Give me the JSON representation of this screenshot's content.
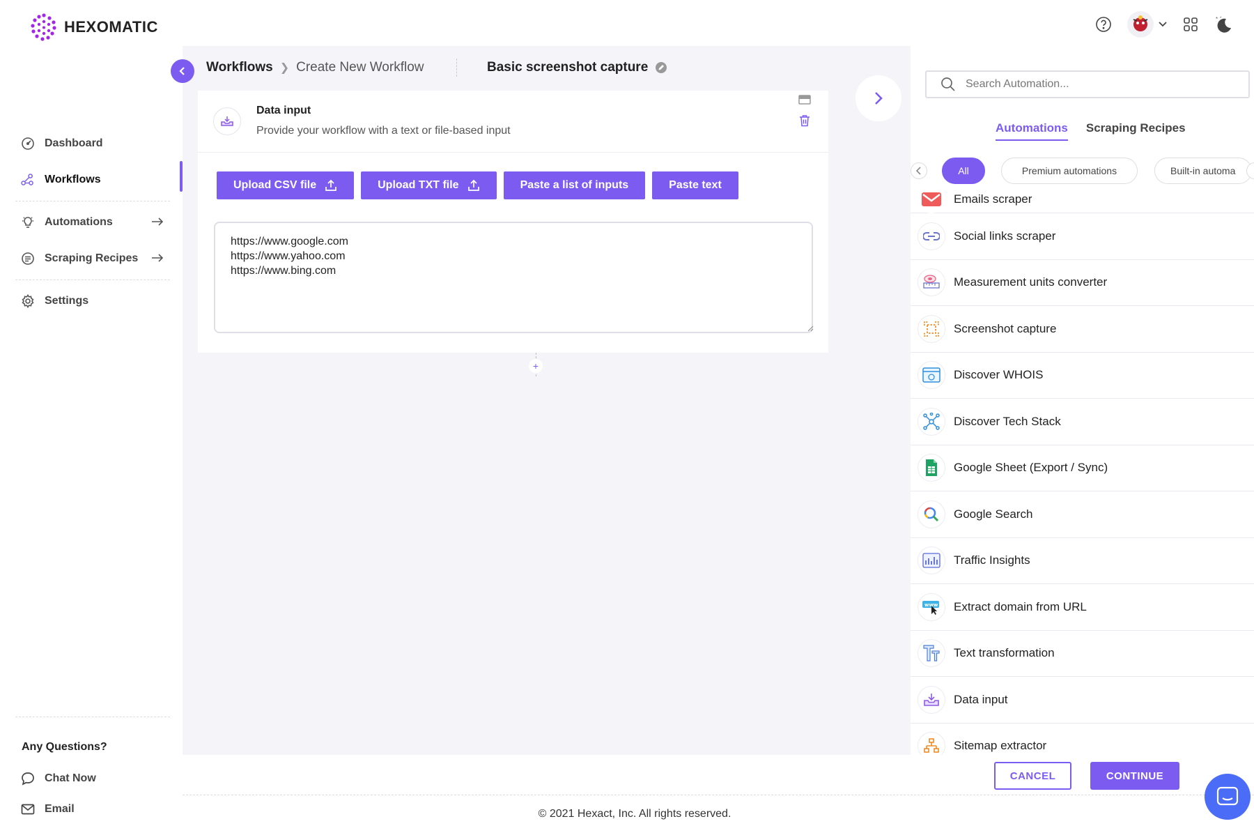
{
  "app": {
    "logo_text": "HEXOMATIC"
  },
  "sidebar": {
    "items": [
      {
        "label": "Dashboard",
        "icon": "dashboard-icon"
      },
      {
        "label": "Workflows",
        "icon": "workflows-icon"
      },
      {
        "label": "Automations",
        "icon": "bulb-icon"
      },
      {
        "label": "Scraping Recipes",
        "icon": "recipes-icon"
      },
      {
        "label": "Settings",
        "icon": "gear-icon"
      }
    ],
    "questions_title": "Any Questions?",
    "chat_label": "Chat Now",
    "email_label": "Email"
  },
  "breadcrumb": {
    "root": "Workflows",
    "current": "Create New Workflow"
  },
  "workflow": {
    "title": "Basic screenshot capture"
  },
  "card": {
    "title": "Data input",
    "subtitle": "Provide your workflow with a text or file-based input",
    "buttons": {
      "upload_csv": "Upload CSV file",
      "upload_txt": "Upload TXT file",
      "paste_list": "Paste a list of inputs",
      "paste_text": "Paste text"
    },
    "inputs_value": "https://www.google.com\nhttps://www.yahoo.com\nhttps://www.bing.com"
  },
  "panel": {
    "search_placeholder": "Search Automation...",
    "tabs": [
      "Automations",
      "Scraping Recipes"
    ],
    "chips": [
      "All",
      "Premium automations",
      "Built-in automa"
    ],
    "automations": [
      {
        "label": "Emails scraper",
        "icon": "email-icon"
      },
      {
        "label": "Social links scraper",
        "icon": "link-icon"
      },
      {
        "label": "Measurement units converter",
        "icon": "tape-measure-icon"
      },
      {
        "label": "Screenshot capture",
        "icon": "screenshot-icon"
      },
      {
        "label": "Discover WHOIS",
        "icon": "whois-icon"
      },
      {
        "label": "Discover Tech Stack",
        "icon": "tech-stack-icon"
      },
      {
        "label": "Google Sheet (Export / Sync)",
        "icon": "google-sheet-icon"
      },
      {
        "label": "Google Search",
        "icon": "google-search-icon"
      },
      {
        "label": "Traffic Insights",
        "icon": "traffic-chart-icon"
      },
      {
        "label": "Extract domain from URL",
        "icon": "www-cursor-icon"
      },
      {
        "label": "Text transformation",
        "icon": "text-transform-icon"
      },
      {
        "label": "Data input",
        "icon": "data-input-icon"
      },
      {
        "label": "Sitemap extractor",
        "icon": "sitemap-icon"
      }
    ]
  },
  "actions": {
    "cancel": "CANCEL",
    "continue": "CONTINUE"
  },
  "footer": {
    "copyright": "© 2021 Hexact, Inc. All rights reserved."
  },
  "colors": {
    "accent": "#7c5cf0",
    "chat": "#4a6cf7"
  }
}
